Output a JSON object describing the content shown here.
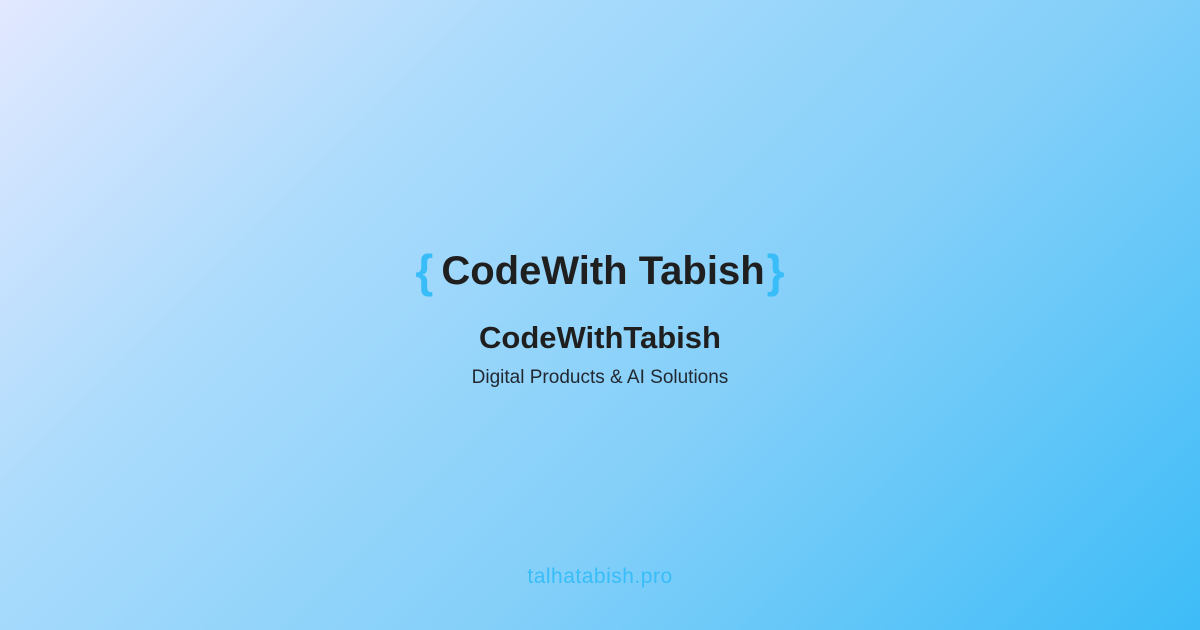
{
  "logo": {
    "brace_open": "{",
    "text": "CodeWith Tabish",
    "brace_close": "}",
    "brace_color": "#38bdf8"
  },
  "brand": {
    "name": "CodeWithTabish",
    "tagline": "Digital Products & AI Solutions"
  },
  "footer": {
    "domain": "talhatabish.pro"
  },
  "colors": {
    "background_start": "#e2e8ff",
    "background_end": "#3dbcf7",
    "text": "#1f1f1f",
    "accent": "#38bdf8"
  }
}
